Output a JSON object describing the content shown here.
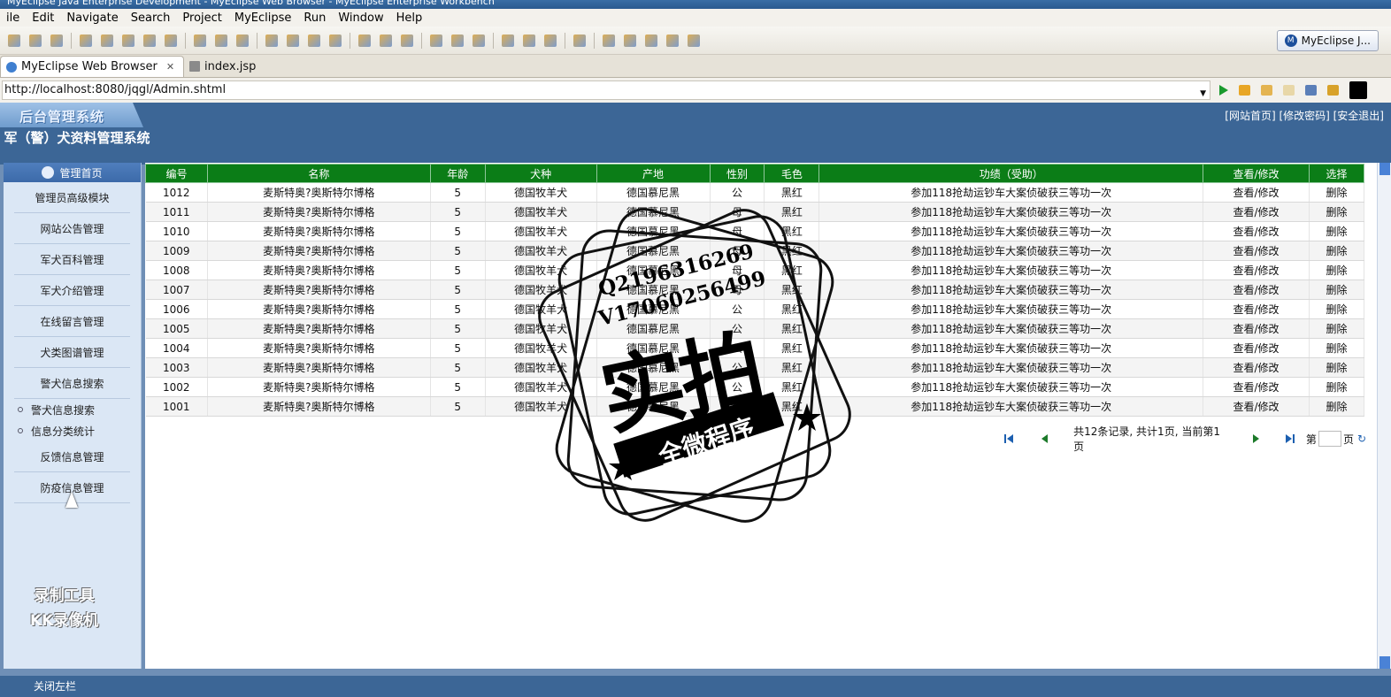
{
  "window": {
    "title": "MyEclipse Java Enterprise Development - MyEclipse Web Browser - MyEclipse Enterprise Workbench"
  },
  "menu": {
    "items": [
      "ile",
      "Edit",
      "Navigate",
      "Search",
      "Project",
      "MyEclipse",
      "Run",
      "Window",
      "Help"
    ]
  },
  "toolbar": {
    "perspective_label": "MyEclipse J..."
  },
  "tabs": [
    {
      "label": "MyEclipse Web Browser",
      "close": "✕"
    },
    {
      "label": "index.jsp"
    }
  ],
  "address": {
    "url": "http://localhost:8080/jqgl/Admin.shtml"
  },
  "header": {
    "logo_text": "后台管理系统",
    "system_title": "军（警）犬资料管理系统",
    "links": "[网站首页] [修改密码] [安全退出]"
  },
  "sidebar": {
    "head_label": "管理首页",
    "items": [
      "管理员高级模块",
      "网站公告管理",
      "军犬百科管理",
      "军犬介绍管理",
      "在线留言管理",
      "犬类图谱管理",
      "警犬信息搜索"
    ],
    "sub_items": [
      "警犬信息搜索",
      "信息分类统计"
    ],
    "items_after": [
      "反馈信息管理",
      "防疫信息管理"
    ],
    "close_label": "关闭左栏",
    "watermark_line1": "录制工具",
    "watermark_line2": "KK录像机"
  },
  "table": {
    "headers": [
      "编号",
      "名称",
      "年龄",
      "犬种",
      "产地",
      "性别",
      "毛色",
      "功绩（受助）",
      "查看/修改",
      "选择"
    ],
    "rows": [
      [
        "1012",
        "麦斯特奥?奥斯特尔博格",
        "5",
        "德国牧羊犬",
        "德国慕尼黑",
        "公",
        "黑红",
        "参加118抢劫运钞车大案侦破获三等功一次",
        "查看/修改",
        "删除"
      ],
      [
        "1011",
        "麦斯特奥?奥斯特尔博格",
        "5",
        "德国牧羊犬",
        "德国慕尼黑",
        "母",
        "黑红",
        "参加118抢劫运钞车大案侦破获三等功一次",
        "查看/修改",
        "删除"
      ],
      [
        "1010",
        "麦斯特奥?奥斯特尔博格",
        "5",
        "德国牧羊犬",
        "德国慕尼黑",
        "母",
        "黑红",
        "参加118抢劫运钞车大案侦破获三等功一次",
        "查看/修改",
        "删除"
      ],
      [
        "1009",
        "麦斯特奥?奥斯特尔博格",
        "5",
        "德国牧羊犬",
        "德国慕尼黑",
        "母",
        "黑红",
        "参加118抢劫运钞车大案侦破获三等功一次",
        "查看/修改",
        "删除"
      ],
      [
        "1008",
        "麦斯特奥?奥斯特尔博格",
        "5",
        "德国牧羊犬",
        "德国慕尼黑",
        "母",
        "黑红",
        "参加118抢劫运钞车大案侦破获三等功一次",
        "查看/修改",
        "删除"
      ],
      [
        "1007",
        "麦斯特奥?奥斯特尔博格",
        "5",
        "德国牧羊犬",
        "德国慕尼黑",
        "母",
        "黑红",
        "参加118抢劫运钞车大案侦破获三等功一次",
        "查看/修改",
        "删除"
      ],
      [
        "1006",
        "麦斯特奥?奥斯特尔博格",
        "5",
        "德国牧羊犬",
        "德国慕尼黑",
        "公",
        "黑红",
        "参加118抢劫运钞车大案侦破获三等功一次",
        "查看/修改",
        "删除"
      ],
      [
        "1005",
        "麦斯特奥?奥斯特尔博格",
        "5",
        "德国牧羊犬",
        "德国慕尼黑",
        "公",
        "黑红",
        "参加118抢劫运钞车大案侦破获三等功一次",
        "查看/修改",
        "删除"
      ],
      [
        "1004",
        "麦斯特奥?奥斯特尔博格",
        "5",
        "德国牧羊犬",
        "德国慕尼黑",
        "公",
        "黑红",
        "参加118抢劫运钞车大案侦破获三等功一次",
        "查看/修改",
        "删除"
      ],
      [
        "1003",
        "麦斯特奥?奥斯特尔博格",
        "5",
        "德国牧羊犬",
        "德国慕尼黑",
        "公",
        "黑红",
        "参加118抢劫运钞车大案侦破获三等功一次",
        "查看/修改",
        "删除"
      ],
      [
        "1002",
        "麦斯特奥?奥斯特尔博格",
        "5",
        "德国牧羊犬",
        "德国慕尼黑",
        "公",
        "黑红",
        "参加118抢劫运钞车大案侦破获三等功一次",
        "查看/修改",
        "删除"
      ],
      [
        "1001",
        "麦斯特奥?奥斯特尔博格",
        "5",
        "德国牧羊犬",
        "德国慕尼黑",
        "公",
        "黑红",
        "参加118抢劫运钞车大案侦破获三等功一次",
        "查看/修改",
        "删除"
      ]
    ]
  },
  "pager": {
    "summary": "共12条记录, 共计1页, 当前第1页",
    "page_prefix": "第",
    "page_suffix": "页"
  },
  "stamp": {
    "line_q": "Q2196316269",
    "line_v": "V17060256499",
    "main": "实拍",
    "banner": "全微程序"
  },
  "colors": {
    "header_bg": "#3c6696",
    "table_header_bg": "#0b7d17",
    "sidebar_bg": "#dbe7f5"
  }
}
